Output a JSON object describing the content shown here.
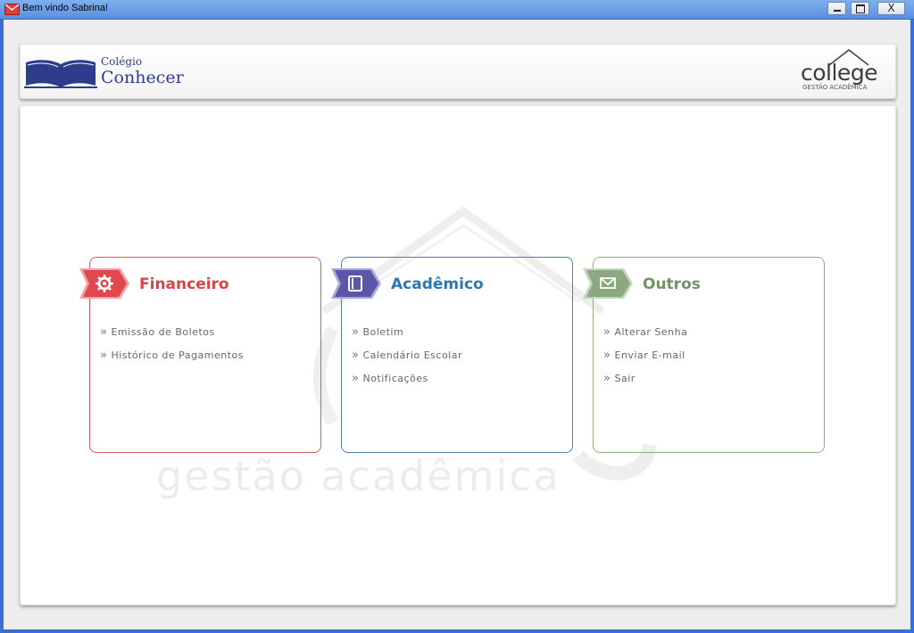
{
  "window": {
    "title": "Bem vindo Sabrina!",
    "close_glyph": "X"
  },
  "header": {
    "logo_left": {
      "line1": "Colégio",
      "line2": "Conhecer"
    },
    "logo_right": {
      "brand": "college",
      "tagline": "GESTÃO ACADÊMICA"
    }
  },
  "watermark": {
    "text": "gestão acadêmica"
  },
  "cards": [
    {
      "title": "Financeiro",
      "icon": "gear-icon",
      "color": "#e0474f",
      "links": [
        "Emissão de Boletos",
        "Histórico de Pagamentos"
      ]
    },
    {
      "title": "Acadêmico",
      "icon": "notebook-icon",
      "color": "#5a56a8",
      "links": [
        "Boletim",
        "Calendário Escolar",
        "Notificações"
      ]
    },
    {
      "title": "Outros",
      "icon": "envelope-icon",
      "color": "#8ba87f",
      "links": [
        "Alterar Senha",
        "Enviar E-mail",
        "Sair"
      ]
    }
  ],
  "link_prefix": "»"
}
